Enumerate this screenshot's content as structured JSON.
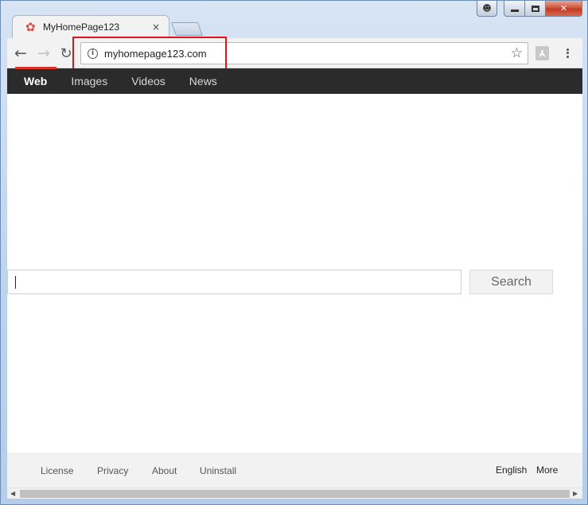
{
  "window": {
    "caption_user_icon": "user-icon",
    "min_icon": "minimize-icon",
    "max_icon": "maximize-icon",
    "close_glyph": "✕"
  },
  "tab": {
    "title": "MyHomePage123",
    "favicon_glyph": "✿",
    "close_glyph": "×"
  },
  "toolbar": {
    "back_glyph": "←",
    "forward_glyph": "→",
    "reload_glyph": "↻",
    "info_glyph": "i",
    "url": "myhomepage123.com",
    "star_glyph": "☆",
    "ext_glyph": "⅄"
  },
  "nav": {
    "items": [
      "Web",
      "Images",
      "Videos",
      "News"
    ],
    "active": "Web"
  },
  "search": {
    "value": "",
    "button_label": "Search"
  },
  "footer": {
    "links": [
      "License",
      "Privacy",
      "About",
      "Uninstall"
    ],
    "language": "English",
    "more": "More"
  },
  "scrollbar": {
    "left_glyph": "◀",
    "right_glyph": "▶"
  },
  "colors": {
    "accent": "#d9332a",
    "highlight_box": "#e0141a",
    "nav_bg": "#2b2b2b"
  }
}
